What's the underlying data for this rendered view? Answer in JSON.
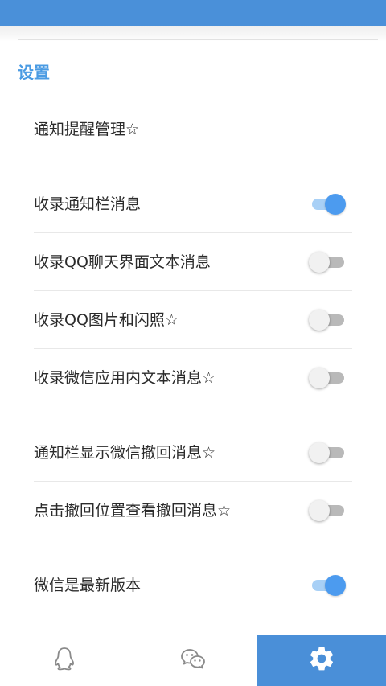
{
  "settings": {
    "title": "设置",
    "items": [
      {
        "label": "通知提醒管理☆"
      },
      {
        "label": "收录通知栏消息",
        "toggle": "on"
      },
      {
        "label": "收录QQ聊天界面文本消息",
        "toggle": "off"
      },
      {
        "label": "收录QQ图片和闪照☆",
        "toggle": "off"
      },
      {
        "label": "收录微信应用内文本消息☆",
        "toggle": "off"
      },
      {
        "label": "通知栏显示微信撤回消息☆",
        "toggle": "off"
      },
      {
        "label": "点击撤回位置查看撤回消息☆",
        "toggle": "off"
      },
      {
        "label": "微信是最新版本",
        "toggle": "on"
      }
    ]
  },
  "bottom_nav": {
    "tabs": [
      {
        "icon": "qq-icon",
        "active": false
      },
      {
        "icon": "wechat-icon",
        "active": false
      },
      {
        "icon": "gear-icon",
        "active": true
      }
    ]
  },
  "colors": {
    "accent": "#4a90d9",
    "title": "#4a9be3",
    "toggle_on": "#4c9bef"
  }
}
